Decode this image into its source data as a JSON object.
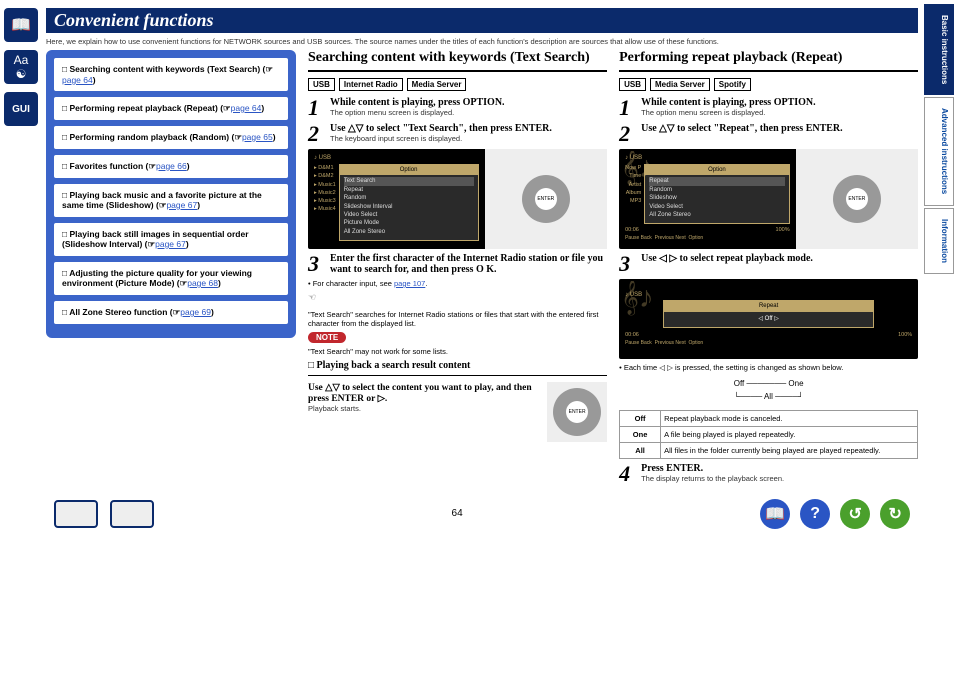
{
  "page_number": "64",
  "title": "Convenient functions",
  "intro": "Here, we explain how to use convenient functions for NETWORK sources and USB sources. The source names under the titles of each function's description are sources that allow use of these functions.",
  "side_tabs": {
    "a": "Basic instructions",
    "b": "Advanced instructions",
    "c": "Information"
  },
  "nav_icons": {
    "book": "📖",
    "aa": "Aa",
    "gui": "GUI"
  },
  "toc": [
    {
      "label": "Searching content with keywords (Text Search)",
      "page": "page 64"
    },
    {
      "label": "Performing repeat playback (Repeat)",
      "page": "page 64"
    },
    {
      "label": "Performing random playback (Random)",
      "page": "page 65"
    },
    {
      "label": "Favorites function",
      "page": "page 66"
    },
    {
      "label": "Playing back music and a favorite picture at the same time (Slideshow)",
      "page": "page 67"
    },
    {
      "label": "Playing back still images in sequential order (Slideshow Interval)",
      "page": "page 67"
    },
    {
      "label": "Adjusting the picture quality for your viewing environment (Picture Mode)",
      "page": "page 68"
    },
    {
      "label": "All Zone Stereo function",
      "page": "page 69"
    }
  ],
  "search": {
    "heading": "Searching content with keywords (Text Search)",
    "tags": [
      "USB",
      "Internet Radio",
      "Media Server"
    ],
    "step1": {
      "main": "While content is playing, press OPTION.",
      "sub": "The option menu screen is displayed."
    },
    "step2": {
      "main": "Use △▽ to select \"Text Search\", then press ENTER.",
      "sub": "The keyboard input screen is displayed."
    },
    "menu_title": "Option",
    "menu_left": [
      "D&M1",
      "D&M2",
      "Music1",
      "Music2",
      "Music3",
      "Music4"
    ],
    "menu_items": [
      "Text Search",
      "Repeat",
      "Random",
      "Slideshow Interval",
      "Video Select",
      "Picture Mode",
      "All Zone Stereo"
    ],
    "usb_label": "USB",
    "step3": "Enter the first character of the Internet Radio station or file you want to search for, and then press O K.",
    "char_input": "For character input, see ",
    "char_input_link": "page 107",
    "desc": "\"Text Search\" searches for Internet Radio stations or files that start with the entered first character from the displayed list.",
    "note_label": "NOTE",
    "note_text": "\"Text Search\" may not work for some lists.",
    "sub_heading": "□ Playing back a search result content",
    "sub_body": "Use △▽ to select the content you want to play, and then press ENTER or ▷.",
    "sub_after": "Playback starts."
  },
  "repeat": {
    "heading": "Performing repeat playback (Repeat)",
    "tags": [
      "USB",
      "Media Server",
      "Spotify"
    ],
    "step1": {
      "main": "While content is playing, press OPTION.",
      "sub": "The option menu screen is displayed."
    },
    "step2": {
      "main": "Use △▽ to select \"Repeat\", then press ENTER."
    },
    "menu_title": "Option",
    "menu_items": [
      "Repeat",
      "Random",
      "Slideshow",
      "Video Select",
      "All Zone Stereo"
    ],
    "menu_left_labels": [
      "Now P",
      "Time",
      "Artist",
      "Album",
      "MP3"
    ],
    "usb_label": "USB",
    "step3": {
      "main": "Use ◁ ▷ to select repeat playback mode."
    },
    "repeat_box": "Repeat",
    "repeat_off": "Off",
    "caption": "Each time ◁ ▷ is pressed, the setting is changed as shown below.",
    "diagram": {
      "off": "Off",
      "one": "One",
      "all": "All"
    },
    "modes": [
      {
        "k": "Off",
        "v": "Repeat playback mode is canceled."
      },
      {
        "k": "One",
        "v": "A file being played is played repeatedly."
      },
      {
        "k": "All",
        "v": "All files in the folder currently being played are played repeatedly."
      }
    ],
    "step4": {
      "main": "Press ENTER.",
      "sub": "The display returns to the playback screen."
    },
    "footer_labels": [
      "Pause",
      "Back",
      "Previous",
      "Next",
      "Option"
    ],
    "time": "00:06",
    "pct": "100%"
  },
  "foot_icons": {
    "book": "📖",
    "help": "?",
    "back": "↺",
    "fwd": "↻"
  }
}
